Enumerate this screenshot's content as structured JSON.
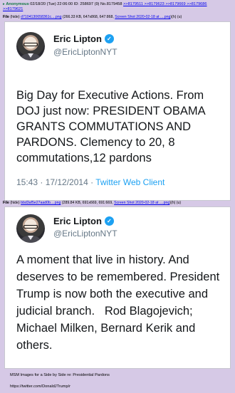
{
  "post": {
    "arrow": "▸",
    "name": "Anonymous",
    "datetime": "02/18/20 (Tue) 22:06:00",
    "id_label": "ID: 258697 (9)",
    "number": "No.8179458",
    "replies_line1": ">>8179511  >>8179623  >>8179669  >>8179686",
    "replies_line2": ">>8179621"
  },
  "file1": {
    "label": "File",
    "hide": "(hide)",
    "filename": "d7104130658361c....png",
    "info": "(266.33 KB, 647x868, 647:868,",
    "full_name": "Screen Shot 2020-02-18 at ....png",
    "tools": ")(h) (u)"
  },
  "file2": {
    "label": "File",
    "hide": "(hide)",
    "filename": "bbd3af5e27aad0b....png",
    "info": "(289.84 KB, 691x669, 691:669,",
    "full_name": "Screen Shot 2020-02-18 at ....png",
    "tools": ")(h) (u)"
  },
  "tweet1": {
    "display_name": "Eric Lipton",
    "handle": "@EricLiptonNYT",
    "text": "Big Day for Executive Actions. From DOJ just now: PRESIDENT OBAMA GRANTS COMMUTATIONS AND PARDONS. Clemency to 20, 8 commutations,12 pardons",
    "time": "15:43 · 17/12/2014 · ",
    "source": "Twitter Web Client"
  },
  "tweet2": {
    "display_name": "Eric Lipton",
    "handle": "@EricLiptonNYT",
    "text": "A moment that live in history. And deserves to be remembered. President Trump is now both the executive and judicial branch.   Rod Blagojevich; Michael Milken, Bernard Kerik and others."
  },
  "caption": {
    "line1": "MSM Images for a Side by Side re: Presidential Pardons",
    "line2": "https://twitter.com/DonaldJTrump/r"
  },
  "colors": {
    "board_bg": "#d6c9e6",
    "name_green": "#117743",
    "link_blue": "#0000ee",
    "twitter_blue": "#1da1f2"
  }
}
